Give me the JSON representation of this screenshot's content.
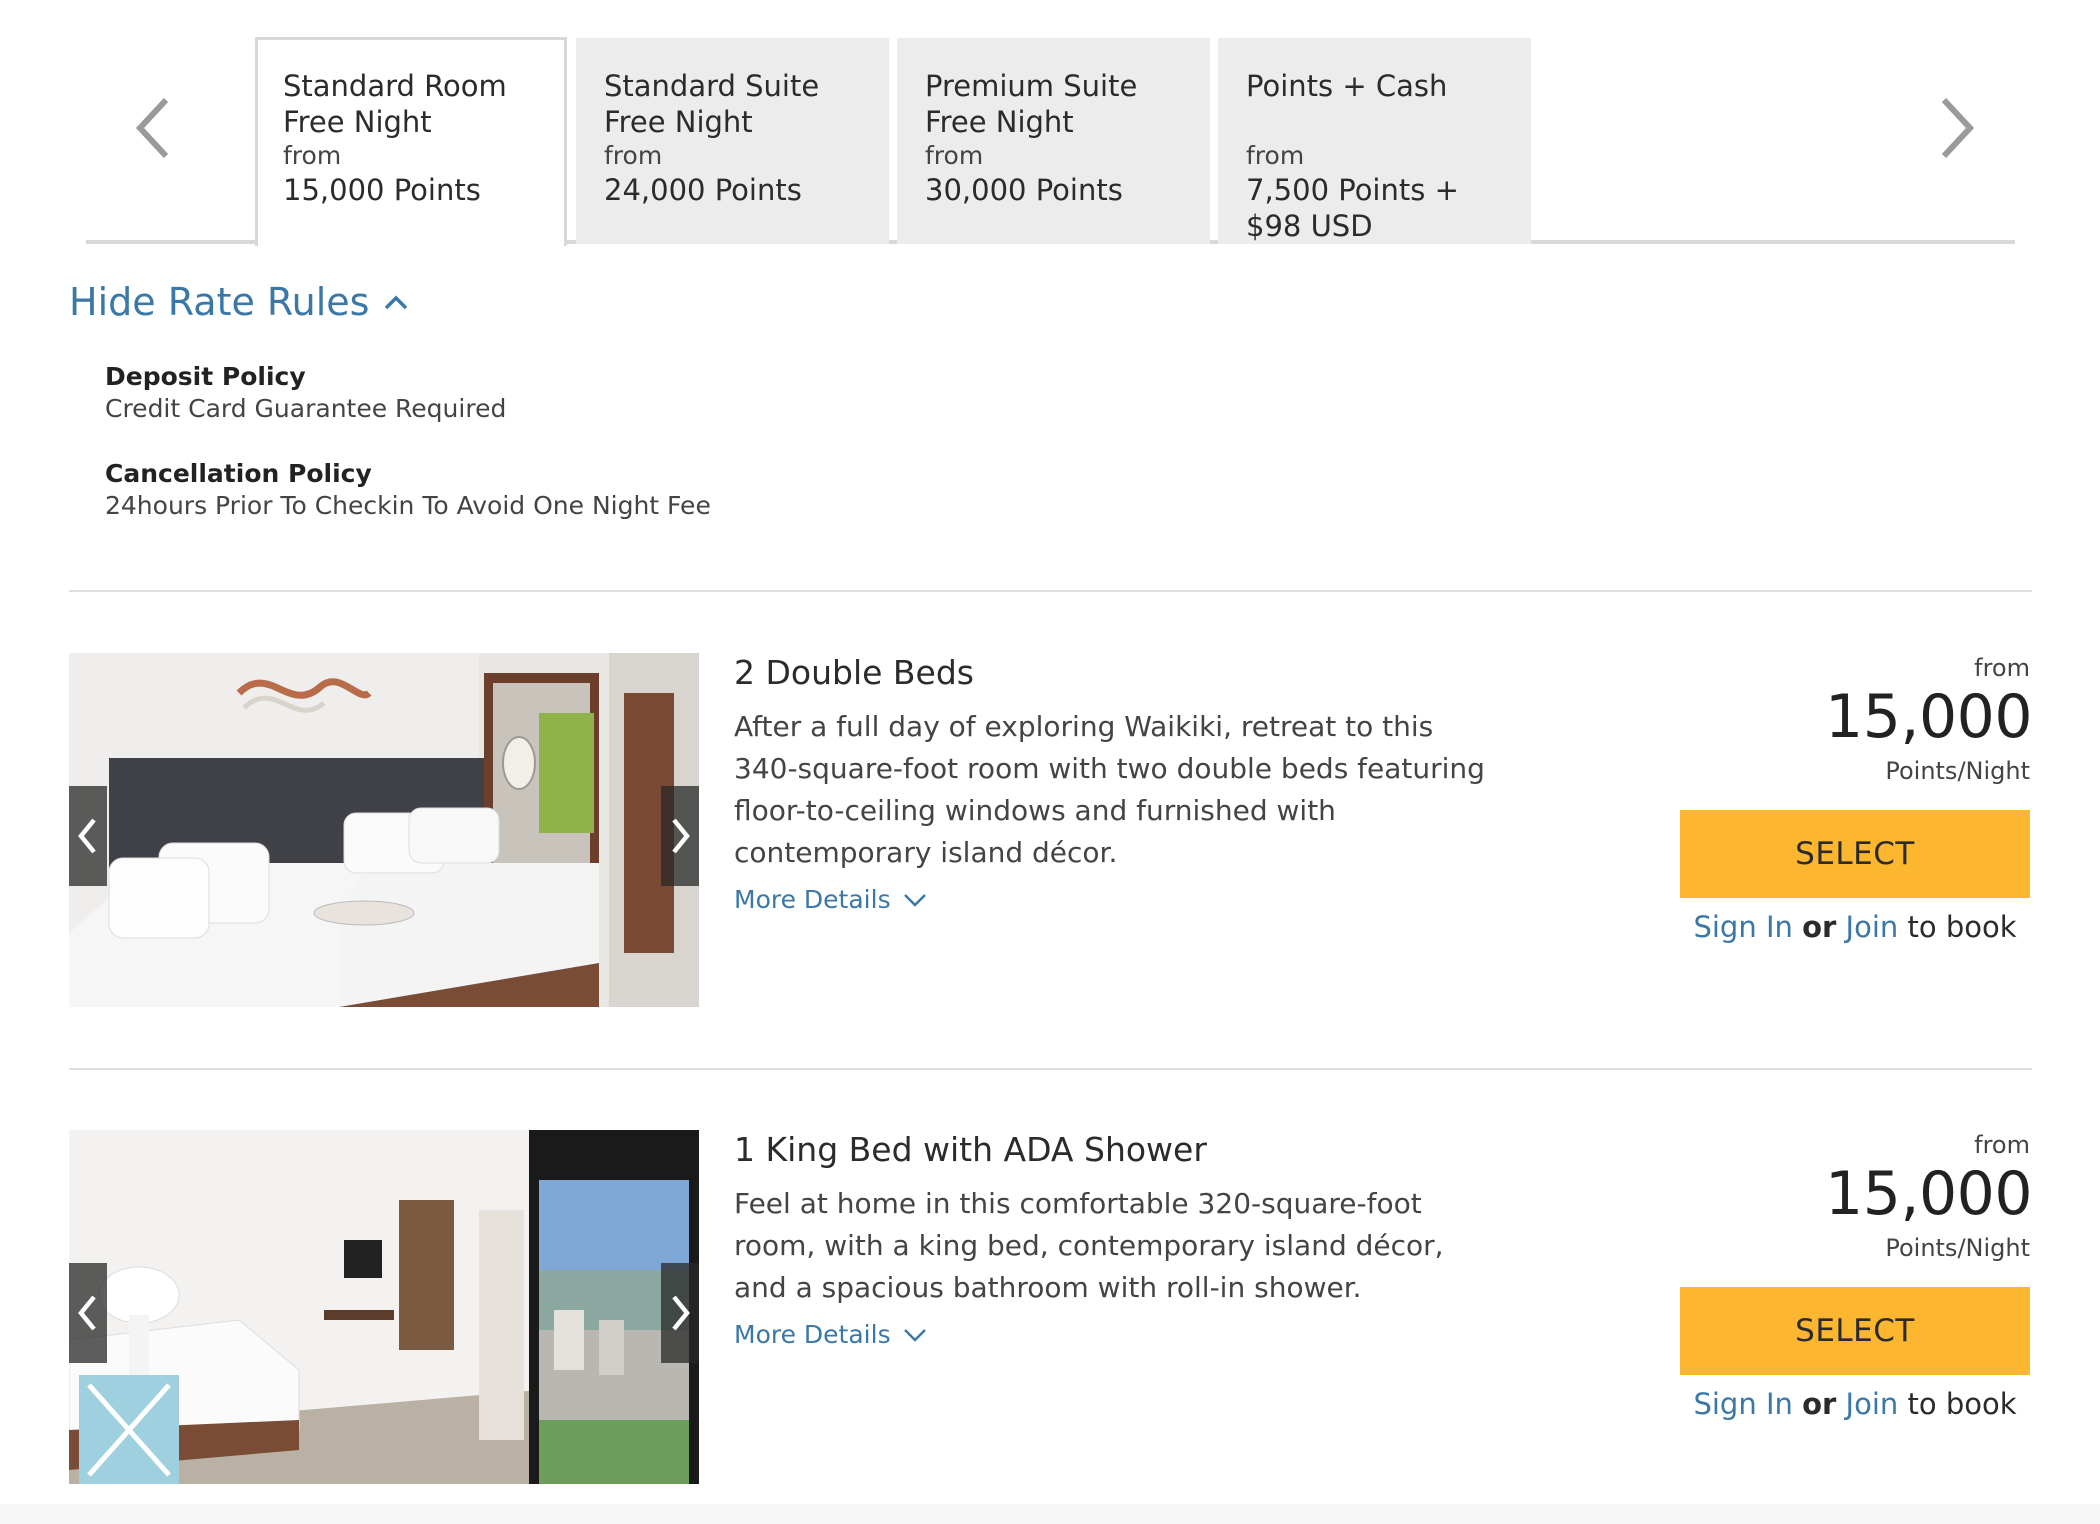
{
  "rate_tabs": [
    {
      "line1": "Standard Room",
      "line2": "Free Night",
      "from": "from",
      "price": "15,000 Points",
      "price2": ""
    },
    {
      "line1": "Standard Suite",
      "line2": "Free Night",
      "from": "from",
      "price": "24,000 Points",
      "price2": ""
    },
    {
      "line1": "Premium Suite",
      "line2": "Free Night",
      "from": "from",
      "price": "30,000 Points",
      "price2": ""
    },
    {
      "line1": "Points + Cash",
      "line2": "",
      "from": "from",
      "price": "7,500 Points +",
      "price2": "$98 USD"
    }
  ],
  "rate_rules": {
    "toggle_label": "Hide Rate Rules",
    "deposit_title": "Deposit Policy",
    "deposit_text": "Credit Card Guarantee Required",
    "cancel_title": "Cancellation Policy",
    "cancel_text": "24hours Prior To Checkin To Avoid One Night Fee"
  },
  "rooms": [
    {
      "title": "2 Double Beds",
      "description": "After a full day of exploring Waikiki, retreat to this 340-square-foot room with two double beds featuring floor-to-ceiling windows and furnished with contemporary island décor.",
      "more_details": "More Details",
      "from": "from",
      "price": "15,000",
      "unit": "Points/Night",
      "select": "SELECT",
      "sign_in": "Sign In",
      "or": "or",
      "join": "Join",
      "to_book": "to book"
    },
    {
      "title": "1 King Bed with ADA Shower",
      "description": "Feel at home in this comfortable 320-square-foot room, with a king bed, contemporary island décor, and a spacious bathroom with roll-in shower.",
      "more_details": "More Details",
      "from": "from",
      "price": "15,000",
      "unit": "Points/Night",
      "select": "SELECT",
      "sign_in": "Sign In",
      "or": "or",
      "join": "Join",
      "to_book": "to book"
    }
  ],
  "colors": {
    "accent": "#3a78a8",
    "select": "#fdb62f",
    "tab_bg": "#ececec",
    "divider": "#dedede"
  }
}
